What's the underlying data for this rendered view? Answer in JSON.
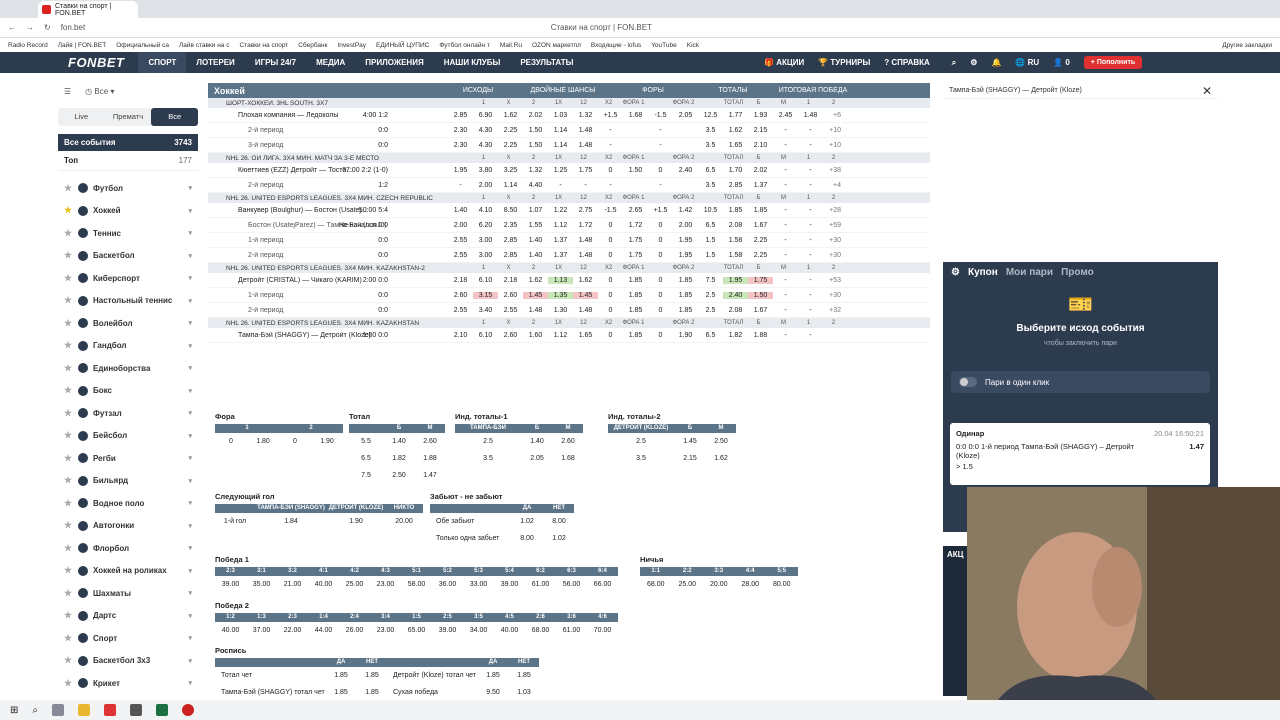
{
  "browser": {
    "tab_title": "Ставки на спорт | FON.BET",
    "url": "fon.bet",
    "page_title": "Ставки на спорт | FON.BET",
    "bookmarks": [
      "Radio Record",
      "Лайв | FON.BET",
      "Официальный са",
      "Лайв ставки на с",
      "Ставки на спорт",
      "Сбербанк",
      "InvestPay",
      "ЕДИНЫЙ ЦУПИС",
      "Футбол онлайн т",
      "Mail.Ru",
      "OZON маркетпл",
      "Входящие - lofus",
      "YouTube",
      "Kick"
    ],
    "other_bm": "Другие закладки"
  },
  "header": {
    "logo": "FONBET",
    "nav": [
      "СПОРТ",
      "ЛОТЕРЕИ",
      "ИГРЫ 24/7",
      "МЕДИА",
      "ПРИЛОЖЕНИЯ",
      "НАШИ КЛУБЫ",
      "РЕЗУЛЬТАТЫ"
    ],
    "promo": "АКЦИИ",
    "tourn": "ТУРНИРЫ",
    "help": "СПРАВКА",
    "lang": "RU",
    "balance": "0",
    "topup": "Пополнить"
  },
  "sidebar": {
    "filter": "Все",
    "tabs": [
      "Live",
      "Прематч",
      "Все"
    ],
    "all_events": "Все события",
    "all_count": "3743",
    "top": "Топ",
    "top_count": "177",
    "sports": [
      "Футбол",
      "Хоккей",
      "Теннис",
      "Баскетбол",
      "Киберспорт",
      "Настольный теннис",
      "Волейбол",
      "Гандбол",
      "Единоборства",
      "Бокс",
      "Футзал",
      "Бейсбол",
      "Регби",
      "Бильярд",
      "Водное поло",
      "Автогонки",
      "Флорбол",
      "Хоккей на роликах",
      "Шахматы",
      "Дартс",
      "Спорт",
      "Баскетбол 3x3",
      "Крикет"
    ]
  },
  "main": {
    "title": "Хоккей",
    "groups": [
      "ИСХОДЫ",
      "ДВОЙНЫЕ ШАНСЫ",
      "ФОРЫ",
      "ТОТАЛЫ",
      "ИТОГОВАЯ ПОБЕДА"
    ],
    "cols": [
      "1",
      "X",
      "2",
      "1X",
      "12",
      "X2",
      "ФОРА 1",
      "",
      "ФОРА 2",
      "",
      "ТОТАЛ",
      "Б",
      "М",
      "1",
      "2"
    ],
    "leagues": [
      {
        "name": "ШОРТ-ХОККЕЙ. 3HL SOUTH. 3X7",
        "rows": [
          {
            "name": "Плохая компания — Ледоколы",
            "score": "4:00 1:2",
            "cells": [
              "2.85",
              "6.90",
              "1.62",
              "2.02",
              "1.03",
              "1.32",
              "+1.5",
              "1.68",
              "-1.5",
              "2.05",
              "12.5",
              "1.77",
              "1.93",
              "2.45",
              "1.48"
            ],
            "more": "+6"
          },
          {
            "name": "2-й период",
            "score": "0:0",
            "cells": [
              "2.30",
              "4.30",
              "2.25",
              "1.50",
              "1.14",
              "1.48",
              "-",
              "",
              "-",
              "",
              "3.5",
              "1.62",
              "2.15",
              "-",
              "-"
            ],
            "more": "+10"
          },
          {
            "name": "3-й период",
            "score": "0:0",
            "cells": [
              "2.30",
              "4.30",
              "2.25",
              "1.50",
              "1.14",
              "1.48",
              "-",
              "",
              "-",
              "",
              "3.5",
              "1.65",
              "2.10",
              "-",
              "-"
            ],
            "more": "+10"
          }
        ]
      },
      {
        "name": "NHL 26. ОИ ЛИГА. 3X4 МИН. МАТЧ ЗА 3-Е МЕСТО",
        "rows": [
          {
            "name": "Кюеттиев (EZZ) Детройт — Тосто...",
            "score": "37:00 2:2 (1-0)",
            "cells": [
              "1.95",
              "3.80",
              "3.25",
              "1.32",
              "1.25",
              "1.75",
              "0",
              "1.50",
              "0",
              "2.40",
              "6.5",
              "1.70",
              "2.02",
              "-",
              "-"
            ],
            "more": "+38"
          },
          {
            "name": "2-й период",
            "score": "1:2",
            "cells": [
              "-",
              "2.00",
              "1.14",
              "4.40",
              "-",
              "-",
              "-",
              "",
              "-",
              "",
              "3.5",
              "2.85",
              "1.37",
              "-",
              "-"
            ],
            "more": "+4"
          }
        ]
      },
      {
        "name": "NHL 26. UNITED ESPORTS LEAGUES. 3X4 МИН. CZECH REPUBLIC",
        "rows": [
          {
            "name": "Ванкувер (Boulghur) — Бостон (Usatej...",
            "score": "50:00 5:4",
            "cells": [
              "1.40",
              "4.10",
              "8.50",
              "1.07",
              "1.22",
              "2.75",
              "-1.5",
              "2.65",
              "+1.5",
              "1.42",
              "10.5",
              "1.85",
              "1.85",
              "-",
              "-"
            ],
            "more": "+28"
          },
          {
            "name": "Бостон (UsatejParez) — Тампа-Бэй (LunJJ)",
            "score": "Не начался 0:0",
            "cells": [
              "2.00",
              "6.20",
              "2.35",
              "1.55",
              "1.12",
              "1.72",
              "0",
              "1.72",
              "0",
              "2.00",
              "6.5",
              "2.08",
              "1.67",
              "-",
              "-"
            ],
            "more": "+59"
          },
          {
            "name": "1-й период",
            "score": "0:0",
            "cells": [
              "2.55",
              "3.00",
              "2.85",
              "1.40",
              "1.37",
              "1.48",
              "0",
              "1.75",
              "0",
              "1.95",
              "1.5",
              "1.58",
              "2.25",
              "-",
              "-"
            ],
            "more": "+30"
          },
          {
            "name": "2-й период",
            "score": "0:0",
            "cells": [
              "2.55",
              "3.00",
              "2.85",
              "1.40",
              "1.37",
              "1.48",
              "0",
              "1.75",
              "0",
              "1.95",
              "1.5",
              "1.58",
              "2.25",
              "-",
              "-"
            ],
            "more": "+30"
          }
        ]
      },
      {
        "name": "NHL 26. UNITED ESPORTS LEAGUES. 3X4 МИН. KAZAKHSTAN-2",
        "rows": [
          {
            "name": "Детройт (CRISTAL) — Чикаго (KARIM)",
            "score": "2:00 0:0",
            "cells": [
              "2.18",
              "6.10",
              "2.18",
              "1.62",
              "1.13",
              "1.62",
              "0",
              "1.85",
              "0",
              "1.85",
              "7.5",
              "1.95",
              "1.75",
              "-",
              "-"
            ],
            "more": "+53"
          },
          {
            "name": "1-й период",
            "score": "0:0",
            "cells": [
              "2.60",
              "3.15",
              "2.60",
              "1.45",
              "1.35",
              "1.45",
              "0",
              "1.85",
              "0",
              "1.85",
              "2.5",
              "2.40",
              "1.50",
              "-",
              "-"
            ],
            "more": "+30"
          },
          {
            "name": "2-й период",
            "score": "0:0",
            "cells": [
              "2.55",
              "3.40",
              "2.55",
              "1.48",
              "1.30",
              "1.48",
              "0",
              "1.85",
              "0",
              "1.85",
              "2.5",
              "2.08",
              "1.67",
              "-",
              "-"
            ],
            "more": "+32"
          }
        ]
      },
      {
        "name": "NHL 26. UNITED ESPORTS LEAGUES. 3X4 МИН. KAZAKHSTAN",
        "rows": [
          {
            "name": "Тампа-Бэй (SHAGGY) — Детройт (Kloze)",
            "score": "1:00 0:0",
            "cells": [
              "2.10",
              "6.10",
              "2.60",
              "1.60",
              "1.12",
              "1.65",
              "0",
              "1.85",
              "0",
              "1.90",
              "6.5",
              "1.82",
              "1.88",
              "-",
              "-"
            ],
            "more": ""
          }
        ]
      }
    ]
  },
  "markets": {
    "fora": {
      "title": "Фора",
      "hdr": [
        "1",
        "2"
      ],
      "row": [
        "0",
        "1.80",
        "0",
        "1.90"
      ]
    },
    "total": {
      "title": "Тотал",
      "hdr": [
        "",
        "Б",
        "М"
      ],
      "rows": [
        [
          "5.5",
          "1.40",
          "2.60"
        ],
        [
          "6.5",
          "1.82",
          "1.88"
        ],
        [
          "7.5",
          "2.50",
          "1.47"
        ]
      ]
    },
    "it1": {
      "title": "Инд. тоталы-1",
      "hdr": [
        "ТАМПА-БЭЙ (SHAGGY)",
        "Б",
        "М"
      ],
      "rows": [
        [
          "2.5",
          "1.40",
          "2.60"
        ],
        [
          "3.5",
          "2.05",
          "1.68"
        ]
      ]
    },
    "it2": {
      "title": "Инд. тоталы-2",
      "hdr": [
        "ДЕТРОЙТ (KLOZE)",
        "Б",
        "М"
      ],
      "rows": [
        [
          "2.5",
          "1.45",
          "2.50"
        ],
        [
          "3.5",
          "2.15",
          "1.62"
        ]
      ]
    },
    "next": {
      "title": "Следующий гол",
      "hdr": [
        "",
        "ТАМПА-БЭЙ (SHAGGY)",
        "ДЕТРОЙТ (KLOZE)",
        "НИКТО"
      ],
      "row": [
        "1-й гол",
        "1.84",
        "1.90",
        "20.00"
      ]
    },
    "btts": {
      "title": "Забьют - не забьют",
      "hdr": [
        "",
        "ДА",
        "НЕТ"
      ],
      "rows": [
        [
          "Обе забьют",
          "1.02",
          "8.00"
        ],
        [
          "Только одна забьет",
          "8.00",
          "1.02"
        ]
      ]
    },
    "w1": {
      "title": "Победа 1",
      "hdr": [
        "2:3",
        "3:1",
        "3:2",
        "4:1",
        "4:2",
        "4:3",
        "5:1",
        "5:2",
        "5:3",
        "5:4",
        "6:2",
        "6:3",
        "6:4"
      ],
      "row": [
        "39.00",
        "35.00",
        "21.00",
        "40.00",
        "25.00",
        "23.00",
        "58.00",
        "36.00",
        "33.00",
        "39.00",
        "61.00",
        "56.00",
        "66.00"
      ]
    },
    "draw": {
      "title": "Ничья",
      "hdr": [
        "1:1",
        "2:2",
        "3:3",
        "4:4",
        "5:5"
      ],
      "row": [
        "68.00",
        "25.00",
        "20.00",
        "28.00",
        "80.00"
      ]
    },
    "w2": {
      "title": "Победа 2",
      "hdr": [
        "1:2",
        "1:3",
        "2:3",
        "1:4",
        "2:4",
        "3:4",
        "1:5",
        "2:5",
        "3:5",
        "4:5",
        "2:6",
        "3:6",
        "4:6"
      ],
      "row": [
        "40.00",
        "37.00",
        "22.00",
        "44.00",
        "26.00",
        "23.00",
        "65.00",
        "39.00",
        "34.00",
        "40.00",
        "68.00",
        "61.00",
        "70.00"
      ]
    },
    "ros": {
      "title": "Роспись",
      "hdr": [
        "",
        "ДА",
        "НЕТ",
        "",
        "ДА",
        "НЕТ"
      ],
      "rows": [
        [
          "Тотал чет",
          "1.85",
          "1.85",
          "Детройт (Kloze) тотал чет",
          "1.85",
          "1.85"
        ],
        [
          "Тампа-Бэй (SHAGGY) тотал чет",
          "1.85",
          "1.85",
          "Сухая победа",
          "9.50",
          "1.03"
        ]
      ]
    }
  },
  "right": {
    "title": "Тампа-Бэй (SHAGGY) — Детройт (Kloze)",
    "coupon_tabs": [
      "Купон",
      "Мои пари",
      "Промо"
    ],
    "msg": "Выберите исход события",
    "sub": "чтобы заключить пари",
    "oneclick": "Пари в один клик",
    "bet": {
      "type": "Одинар",
      "time": "20.04 16:50:21",
      "text": "0:0 0:0 1-й период Тампа-Бэй (SHAGGY) – Детройт (Kloze)",
      "line": "> 1.5",
      "odd": "1.47"
    },
    "akc": "АКЦ"
  }
}
